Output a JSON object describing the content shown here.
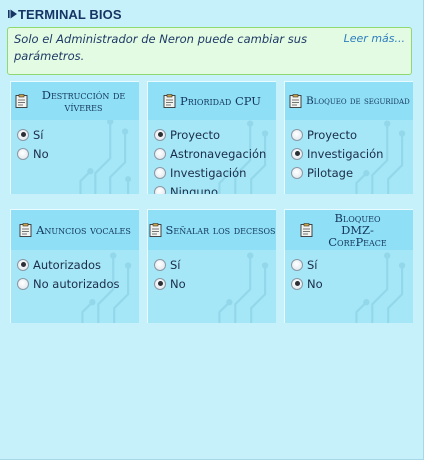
{
  "header": {
    "title": "TERMINAL BIOS"
  },
  "notice": {
    "message": "Solo el Administrador de Neron puede cambiar sus parámetros.",
    "link": "Leer más..."
  },
  "panels": [
    {
      "title": "Destrucción de víveres",
      "options": [
        "Sí",
        "No"
      ],
      "selected": "Sí"
    },
    {
      "title": "Prioridad CPU",
      "options": [
        "Proyecto",
        "Astronavegación",
        "Investigación",
        "Ninguno"
      ],
      "selected": "Proyecto"
    },
    {
      "title": "Bloqueo de seguridad",
      "options": [
        "Proyecto",
        "Investigación",
        "Pilotage"
      ],
      "selected": "Investigación"
    },
    {
      "title": "Anuncios vocales",
      "options": [
        "Autorizados",
        "No autorizados"
      ],
      "selected": "Autorizados"
    },
    {
      "title": "Señalar los decesos",
      "options": [
        "Sí",
        "No"
      ],
      "selected": "No"
    },
    {
      "title": "Bloqueo DMZ-CorePeace",
      "options": [
        "Sí",
        "No"
      ],
      "selected": "No"
    }
  ],
  "colors": {
    "background": "#c6f1fb",
    "panel": "#a5e7f7",
    "panel_header": "#8fe0f7",
    "notice_bg": "#e3fbe2",
    "notice_border": "#8fd96f",
    "link": "#2f7dc0",
    "title": "#173564"
  },
  "icons": {
    "header": "play-triangle-icon",
    "panel": "clipboard-icon"
  }
}
